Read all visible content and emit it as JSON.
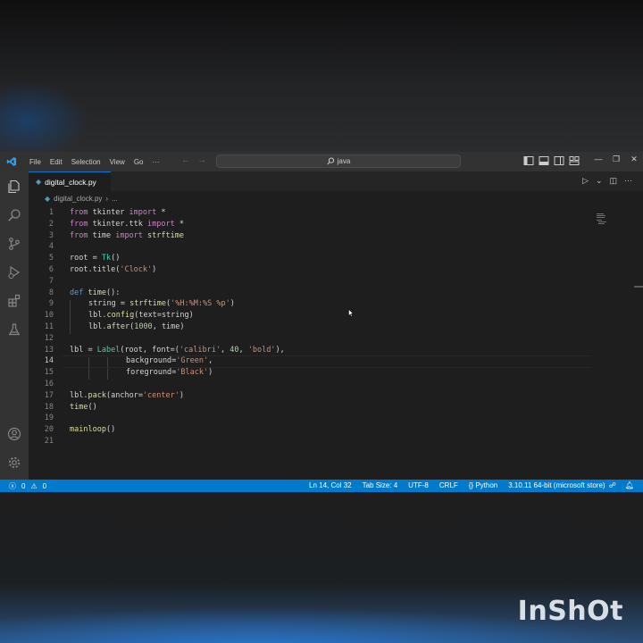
{
  "window": {
    "menu": [
      "File",
      "Edit",
      "Selection",
      "View",
      "Go",
      "···"
    ],
    "search_text": "java",
    "window_controls": [
      "—",
      "❐",
      "✕"
    ]
  },
  "editor": {
    "tab_label": "digital_clock.py",
    "breadcrumb": [
      "digital_clock.py",
      "..."
    ],
    "line_numbers": [
      "1",
      "2",
      "3",
      "4",
      "5",
      "6",
      "7",
      "8",
      "9",
      "10",
      "11",
      "12",
      "13",
      "14",
      "15",
      "16",
      "17",
      "18",
      "19",
      "20",
      "21"
    ],
    "lines": {
      "l1": {
        "a": "from",
        "b": " tkinter ",
        "c": "import",
        "d": " *"
      },
      "l2": {
        "a": "from",
        "b": " tkinter.ttk ",
        "c": "import",
        "d": " *"
      },
      "l3": {
        "a": "from",
        "b": " time ",
        "c": "import",
        "d": " strftime"
      },
      "l5": {
        "a": "root",
        "b": " = ",
        "c": "Tk",
        "d": "()"
      },
      "l6": {
        "a": "root",
        "b": ".",
        "c": "title",
        "d": "(",
        "e": "'Clock'",
        "f": ")"
      },
      "l8": {
        "a": "def",
        "b": " ",
        "c": "time",
        "d": "():"
      },
      "l9": {
        "a": "string",
        "b": " = ",
        "c": "strftime",
        "d": "(",
        "e": "'%H:%M:%S %p'",
        "f": ")"
      },
      "l10": {
        "a": "lbl",
        "b": ".",
        "c": "config",
        "d": "(",
        "e": "text",
        "f": "=",
        "g": "string",
        "h": ")"
      },
      "l11": {
        "a": "lbl",
        "b": ".",
        "c": "after",
        "d": "(",
        "e": "1000",
        "f": ", ",
        "g": "time",
        "h": ")"
      },
      "l13": {
        "a": "lbl",
        "b": " = ",
        "c": "Label",
        "d": "(",
        "e": "root",
        "f": ", ",
        "g": "font",
        "h": "=(",
        "i": "'calibri'",
        "j": ", ",
        "k": "40",
        "l": ", ",
        "m": "'bold'",
        "n": "),"
      },
      "l14": {
        "a": "background",
        "b": "=",
        "c": "'Green'",
        "d": ","
      },
      "l15": {
        "a": "foreground",
        "b": "=",
        "c": "'Black'",
        "d": ")"
      },
      "l17": {
        "a": "lbl",
        "b": ".",
        "c": "pack",
        "d": "(",
        "e": "anchor",
        "f": "=",
        "g": "'center'",
        "h": ")"
      },
      "l18": {
        "a": "time",
        "b": "()"
      },
      "l20": {
        "a": "mainloop",
        "b": "()"
      }
    }
  },
  "statusbar": {
    "errors": "0",
    "warnings": "0",
    "position": "Ln 14, Col 32",
    "tab_size": "Tab Size: 4",
    "encoding": "UTF-8",
    "eol": "CRLF",
    "language": "Python",
    "interpreter": "3.10.11 64-bit (microsoft store)"
  },
  "watermark": "InShOt",
  "colors": {
    "accent": "#007acc",
    "keyword": "#c586c0",
    "function": "#dcdcaa",
    "string": "#ce9178",
    "class": "#4ec9b0",
    "number": "#b5cea8"
  }
}
